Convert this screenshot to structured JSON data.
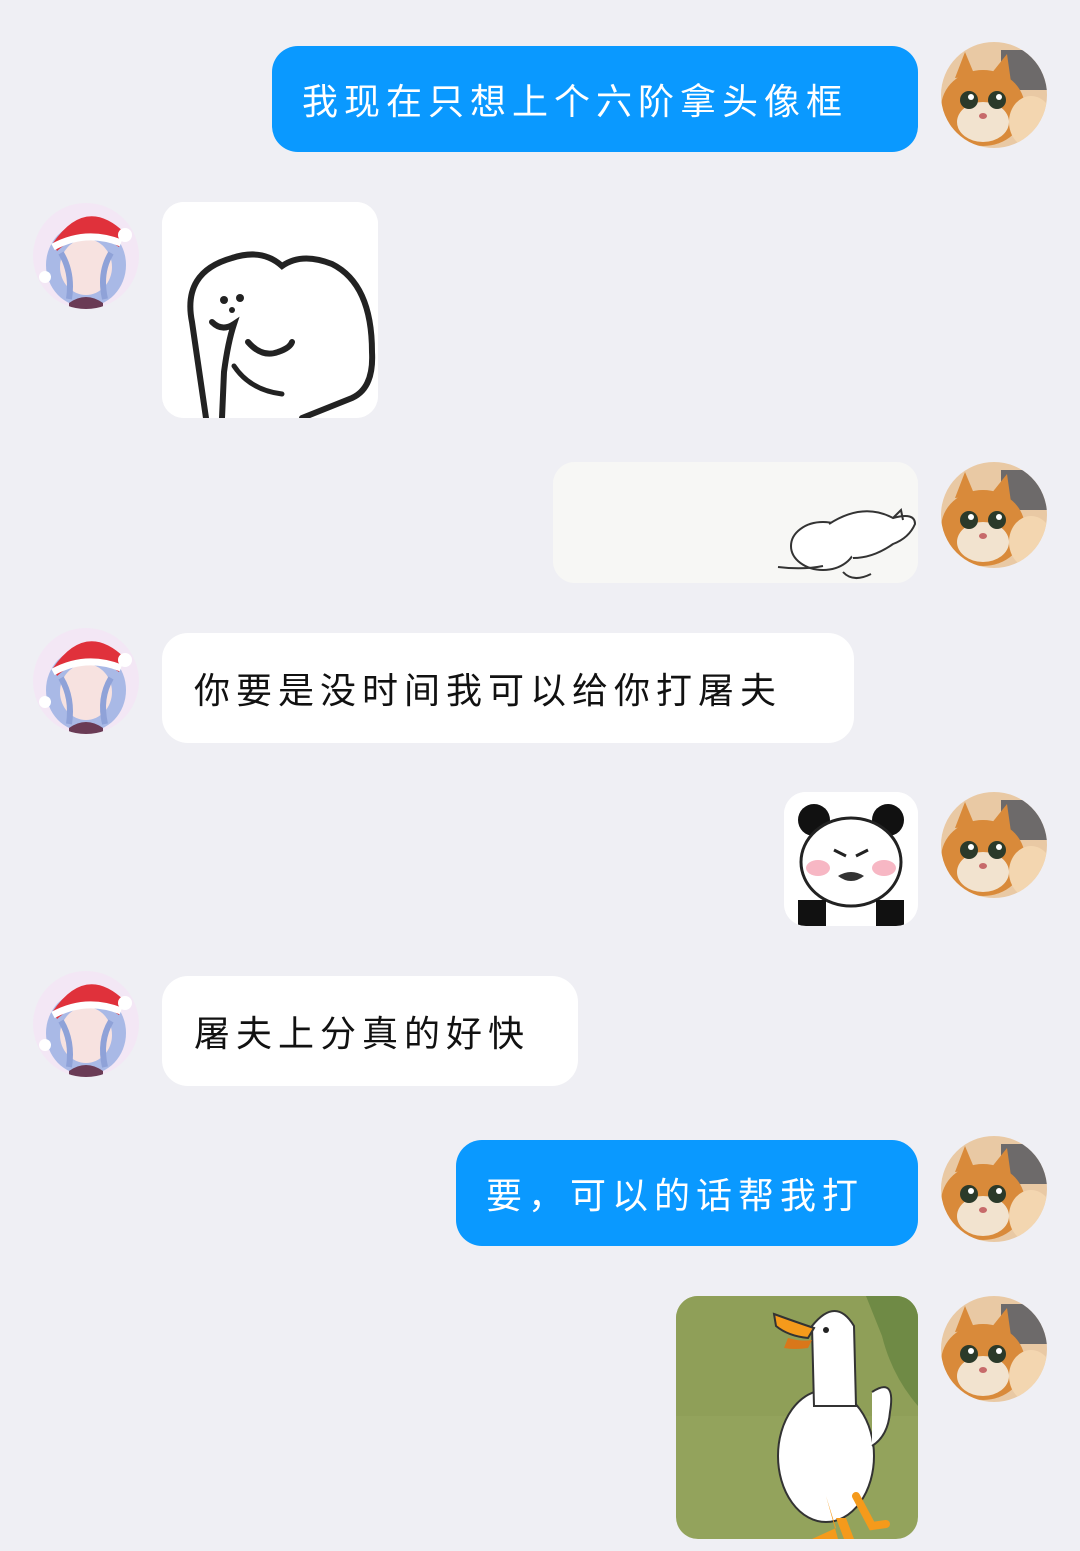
{
  "messages": [
    {
      "from": "me",
      "type": "text",
      "text": "我现在只想上个六阶拿头像框"
    },
    {
      "from": "them",
      "type": "sticker",
      "sticker": "shy-bear-sticker"
    },
    {
      "from": "me",
      "type": "sticker",
      "sticker": "lying-cat-sticker"
    },
    {
      "from": "them",
      "type": "text",
      "text": "你要是没时间我可以给你打屠夫"
    },
    {
      "from": "me",
      "type": "sticker",
      "sticker": "panda-face-sticker"
    },
    {
      "from": "them",
      "type": "text",
      "text": "屠夫上分真的好快"
    },
    {
      "from": "me",
      "type": "text",
      "text": "要，可以的话帮我打"
    },
    {
      "from": "me",
      "type": "sticker",
      "sticker": "walking-duck-sticker"
    }
  ],
  "colors": {
    "me_bubble": "#0a99ff",
    "them_bubble": "#ffffff",
    "background": "#efeff4"
  }
}
